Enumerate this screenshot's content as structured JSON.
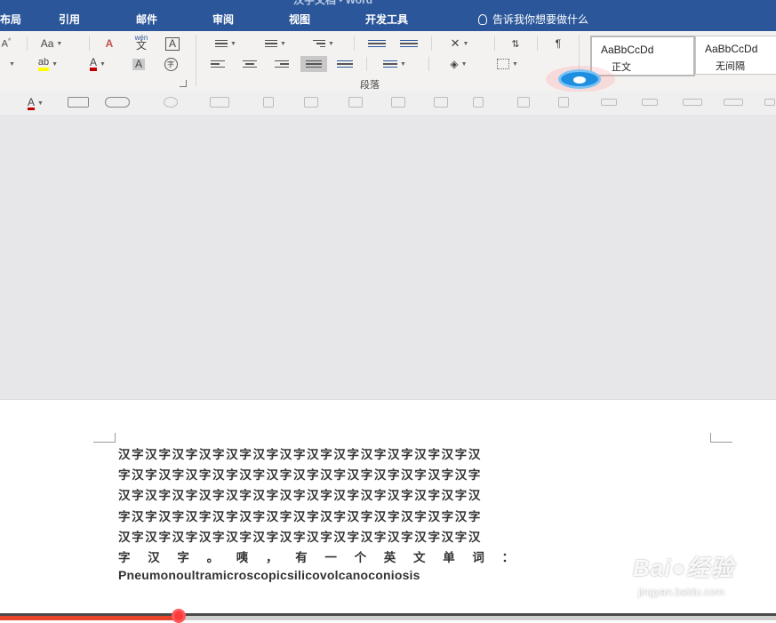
{
  "window": {
    "title": "汉字文档 - Word"
  },
  "menu": {
    "tabs": [
      {
        "label": "布局"
      },
      {
        "label": "引用"
      },
      {
        "label": "邮件"
      },
      {
        "label": "审阅"
      },
      {
        "label": "视图"
      },
      {
        "label": "开发工具"
      }
    ],
    "tell_me": "告诉我你想要做什么"
  },
  "ribbon": {
    "font_case_label": "Aa",
    "phonetic_label": "wén",
    "phonetic_char": "文",
    "char_border_label": "A",
    "highlight_label": "ab",
    "font_color_label": "A",
    "char_shading_label": "A",
    "enclose_char_label": "字",
    "paragraph_group_label": "段落",
    "styles": [
      {
        "sample": "AaBbCcDd",
        "name": "正文"
      },
      {
        "sample": "AaBbCcDd",
        "name": "无间隔"
      }
    ],
    "colors": {
      "highlight": "#ffff00",
      "font_color": "#c00000",
      "ribbon_accent": "#2b579a"
    }
  },
  "drawing_tools": {
    "font_color_label": "A"
  },
  "document": {
    "lines": [
      "汉字汉字汉字汉字汉字汉字汉字汉字汉字汉字汉字汉字汉字汉",
      "字汉字汉字汉字汉字汉字汉字汉字汉字汉字汉字汉字汉字汉字",
      "汉字汉字汉字汉字汉字汉字汉字汉字汉字汉字汉字汉字汉字汉",
      "字汉字汉字汉字汉字汉字汉字汉字汉字汉字汉字汉字汉字汉字",
      "汉字汉字汉字汉字汉字汉字汉字汉字汉字汉字汉字汉字汉字汉",
      "字汉字。咦，有一个英文单词：",
      "Pneumonoultramicroscopicsilicovolcanoconiosis"
    ]
  },
  "watermark": {
    "brand": "Bai●经验",
    "url": "jingyan.baidu.com"
  },
  "video_progress": {
    "played_fraction": 0.23
  }
}
